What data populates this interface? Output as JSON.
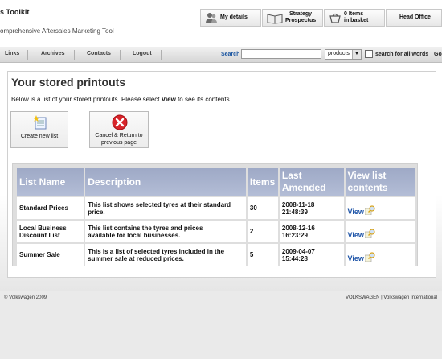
{
  "header": {
    "title": "s Toolkit",
    "subtitle": "omprehensive Aftersales Marketing Tool",
    "buttons": {
      "my_details": "My details",
      "strategy_line1": "Strategy",
      "strategy_line2": "Prospectus",
      "basket_line1": "0 Items",
      "basket_line2": "in basket",
      "head_office": "Head Office"
    }
  },
  "nav": {
    "links": [
      "Links",
      "Archives",
      "Contacts",
      "Logout"
    ],
    "search_label": "Search",
    "search_value": "",
    "search_scope": "products",
    "all_words_label": "search for all words",
    "go_label": "Go"
  },
  "main": {
    "title": "Your stored printouts",
    "intro_before": "Below is a list of your stored printouts. Please select ",
    "intro_bold": "View",
    "intro_after": " to see its contents.",
    "create_button": "Create new list",
    "cancel_line1": "Cancel & Return to",
    "cancel_line2": "previous page"
  },
  "table": {
    "headers": {
      "name": "List Name",
      "description": "Description",
      "items": "Items",
      "amended_line1": "Last",
      "amended_line2": "Amended",
      "view_line1": "View list",
      "view_line2": "contents"
    },
    "rows": [
      {
        "name_line1": "Standard Prices",
        "name_line2": "",
        "desc_line1": "This list shows selected tyres at their standard",
        "desc_line2": "price.",
        "items": "30",
        "date": "2008-11-18",
        "time": "21:48:39",
        "view": "View"
      },
      {
        "name_line1": "Local Business",
        "name_line2": "Discount List",
        "desc_line1": "This list contains the tyres and prices",
        "desc_line2": "available for local businesses.",
        "items": "2",
        "date": "2008-12-16",
        "time": "16:23:29",
        "view": "View"
      },
      {
        "name_line1": "Summer Sale",
        "name_line2": "",
        "desc_line1": "This is a list of selected tyres included in the",
        "desc_line2": "summer sale at reduced prices.",
        "items": "5",
        "date": "2009-04-07",
        "time": "15:44:28",
        "view": "View"
      }
    ]
  },
  "footer": {
    "copyright": "© Volkswagen 2009",
    "right": "VOLKSWAGEN | Volkswagen International"
  },
  "colors": {
    "table_header": "#a8b3cf",
    "link_blue": "#1f55a8",
    "cancel_red": "#d8242a"
  }
}
